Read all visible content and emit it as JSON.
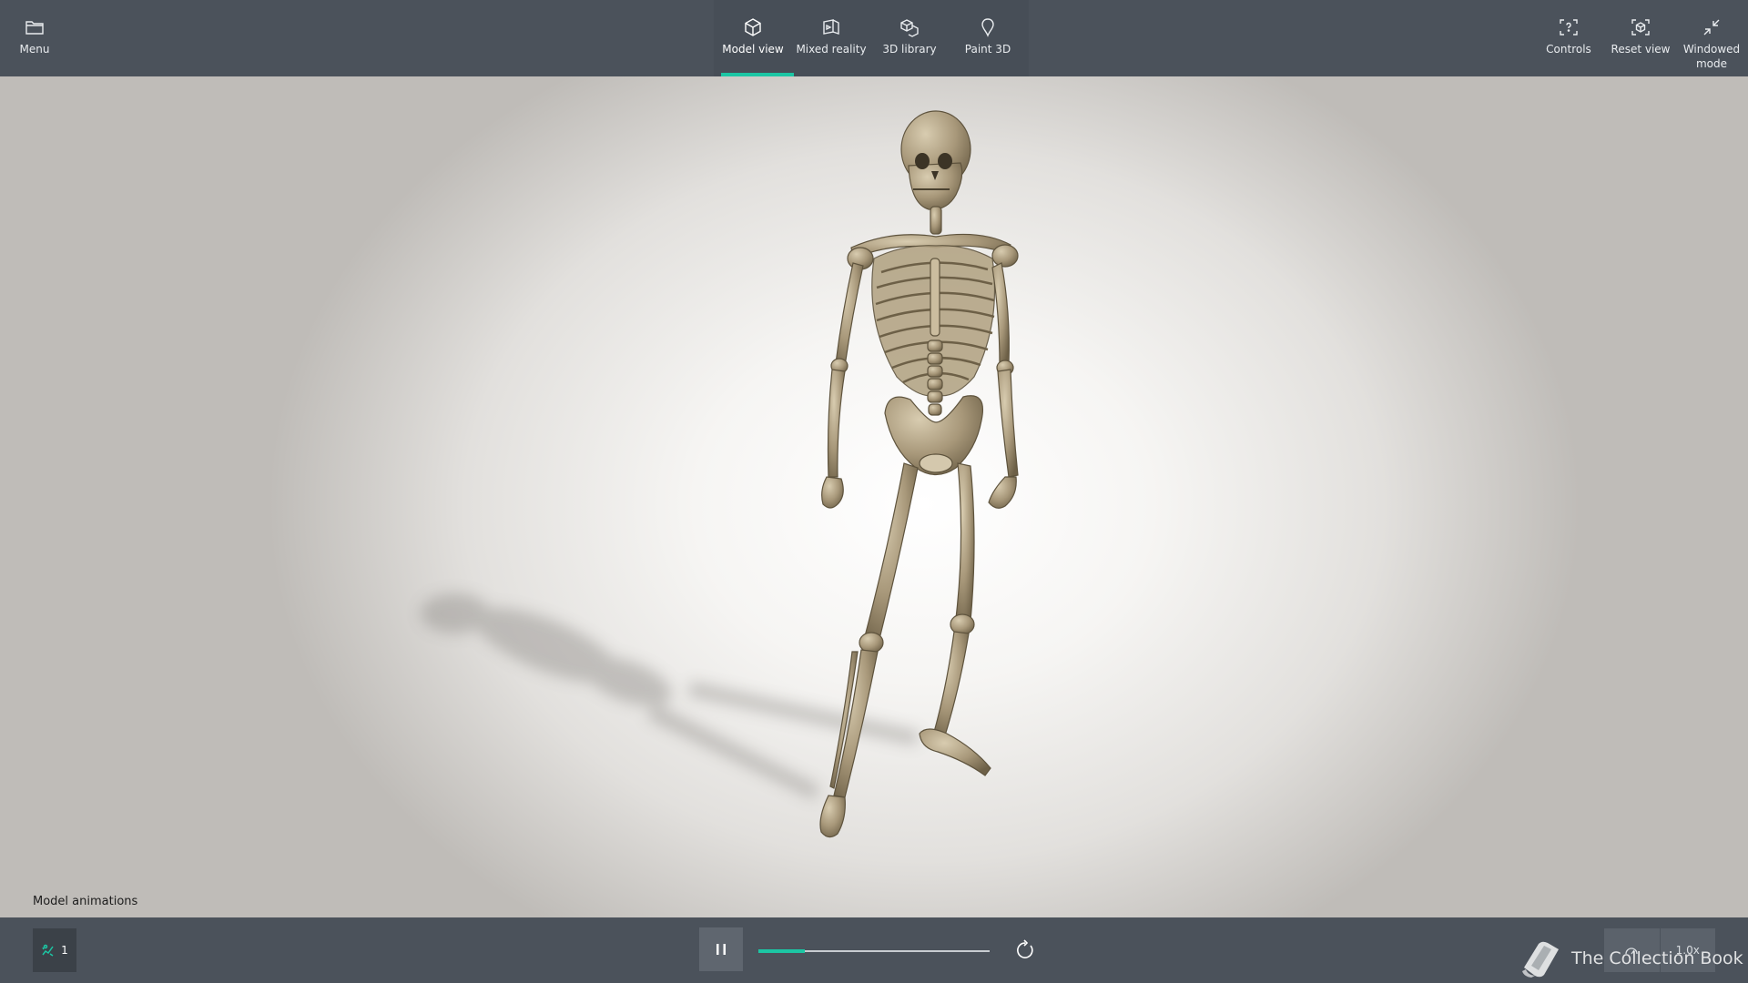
{
  "topbar": {
    "menu_label": "Menu",
    "tabs": [
      {
        "label": "Model view",
        "active": true
      },
      {
        "label": "Mixed reality",
        "active": false
      },
      {
        "label": "3D library",
        "active": false
      },
      {
        "label": "Paint 3D",
        "active": false
      }
    ],
    "controls_label": "Controls",
    "reset_view_label": "Reset view",
    "windowed_mode_label": "Windowed mode"
  },
  "viewport": {
    "model": "skeleton",
    "animations_label": "Model animations"
  },
  "bottombar": {
    "animation_chip_count": "1",
    "playback_state": "playing",
    "timeline_progress": 0.2,
    "speed_value": "1.0x"
  },
  "watermark": {
    "text": "The Collection Book"
  },
  "colors": {
    "bar_background": "#4b525b",
    "accent": "#1cc6a4",
    "bone": "#8c7b5a"
  },
  "icons": [
    "folder-icon",
    "cube-icon",
    "mixed-reality-icon",
    "library-icon",
    "paint-drop-icon",
    "controls-icon",
    "reset-view-icon",
    "collapse-icon",
    "animation-icon",
    "pause-icon",
    "replay-icon",
    "speed-icon",
    "book-icon"
  ]
}
